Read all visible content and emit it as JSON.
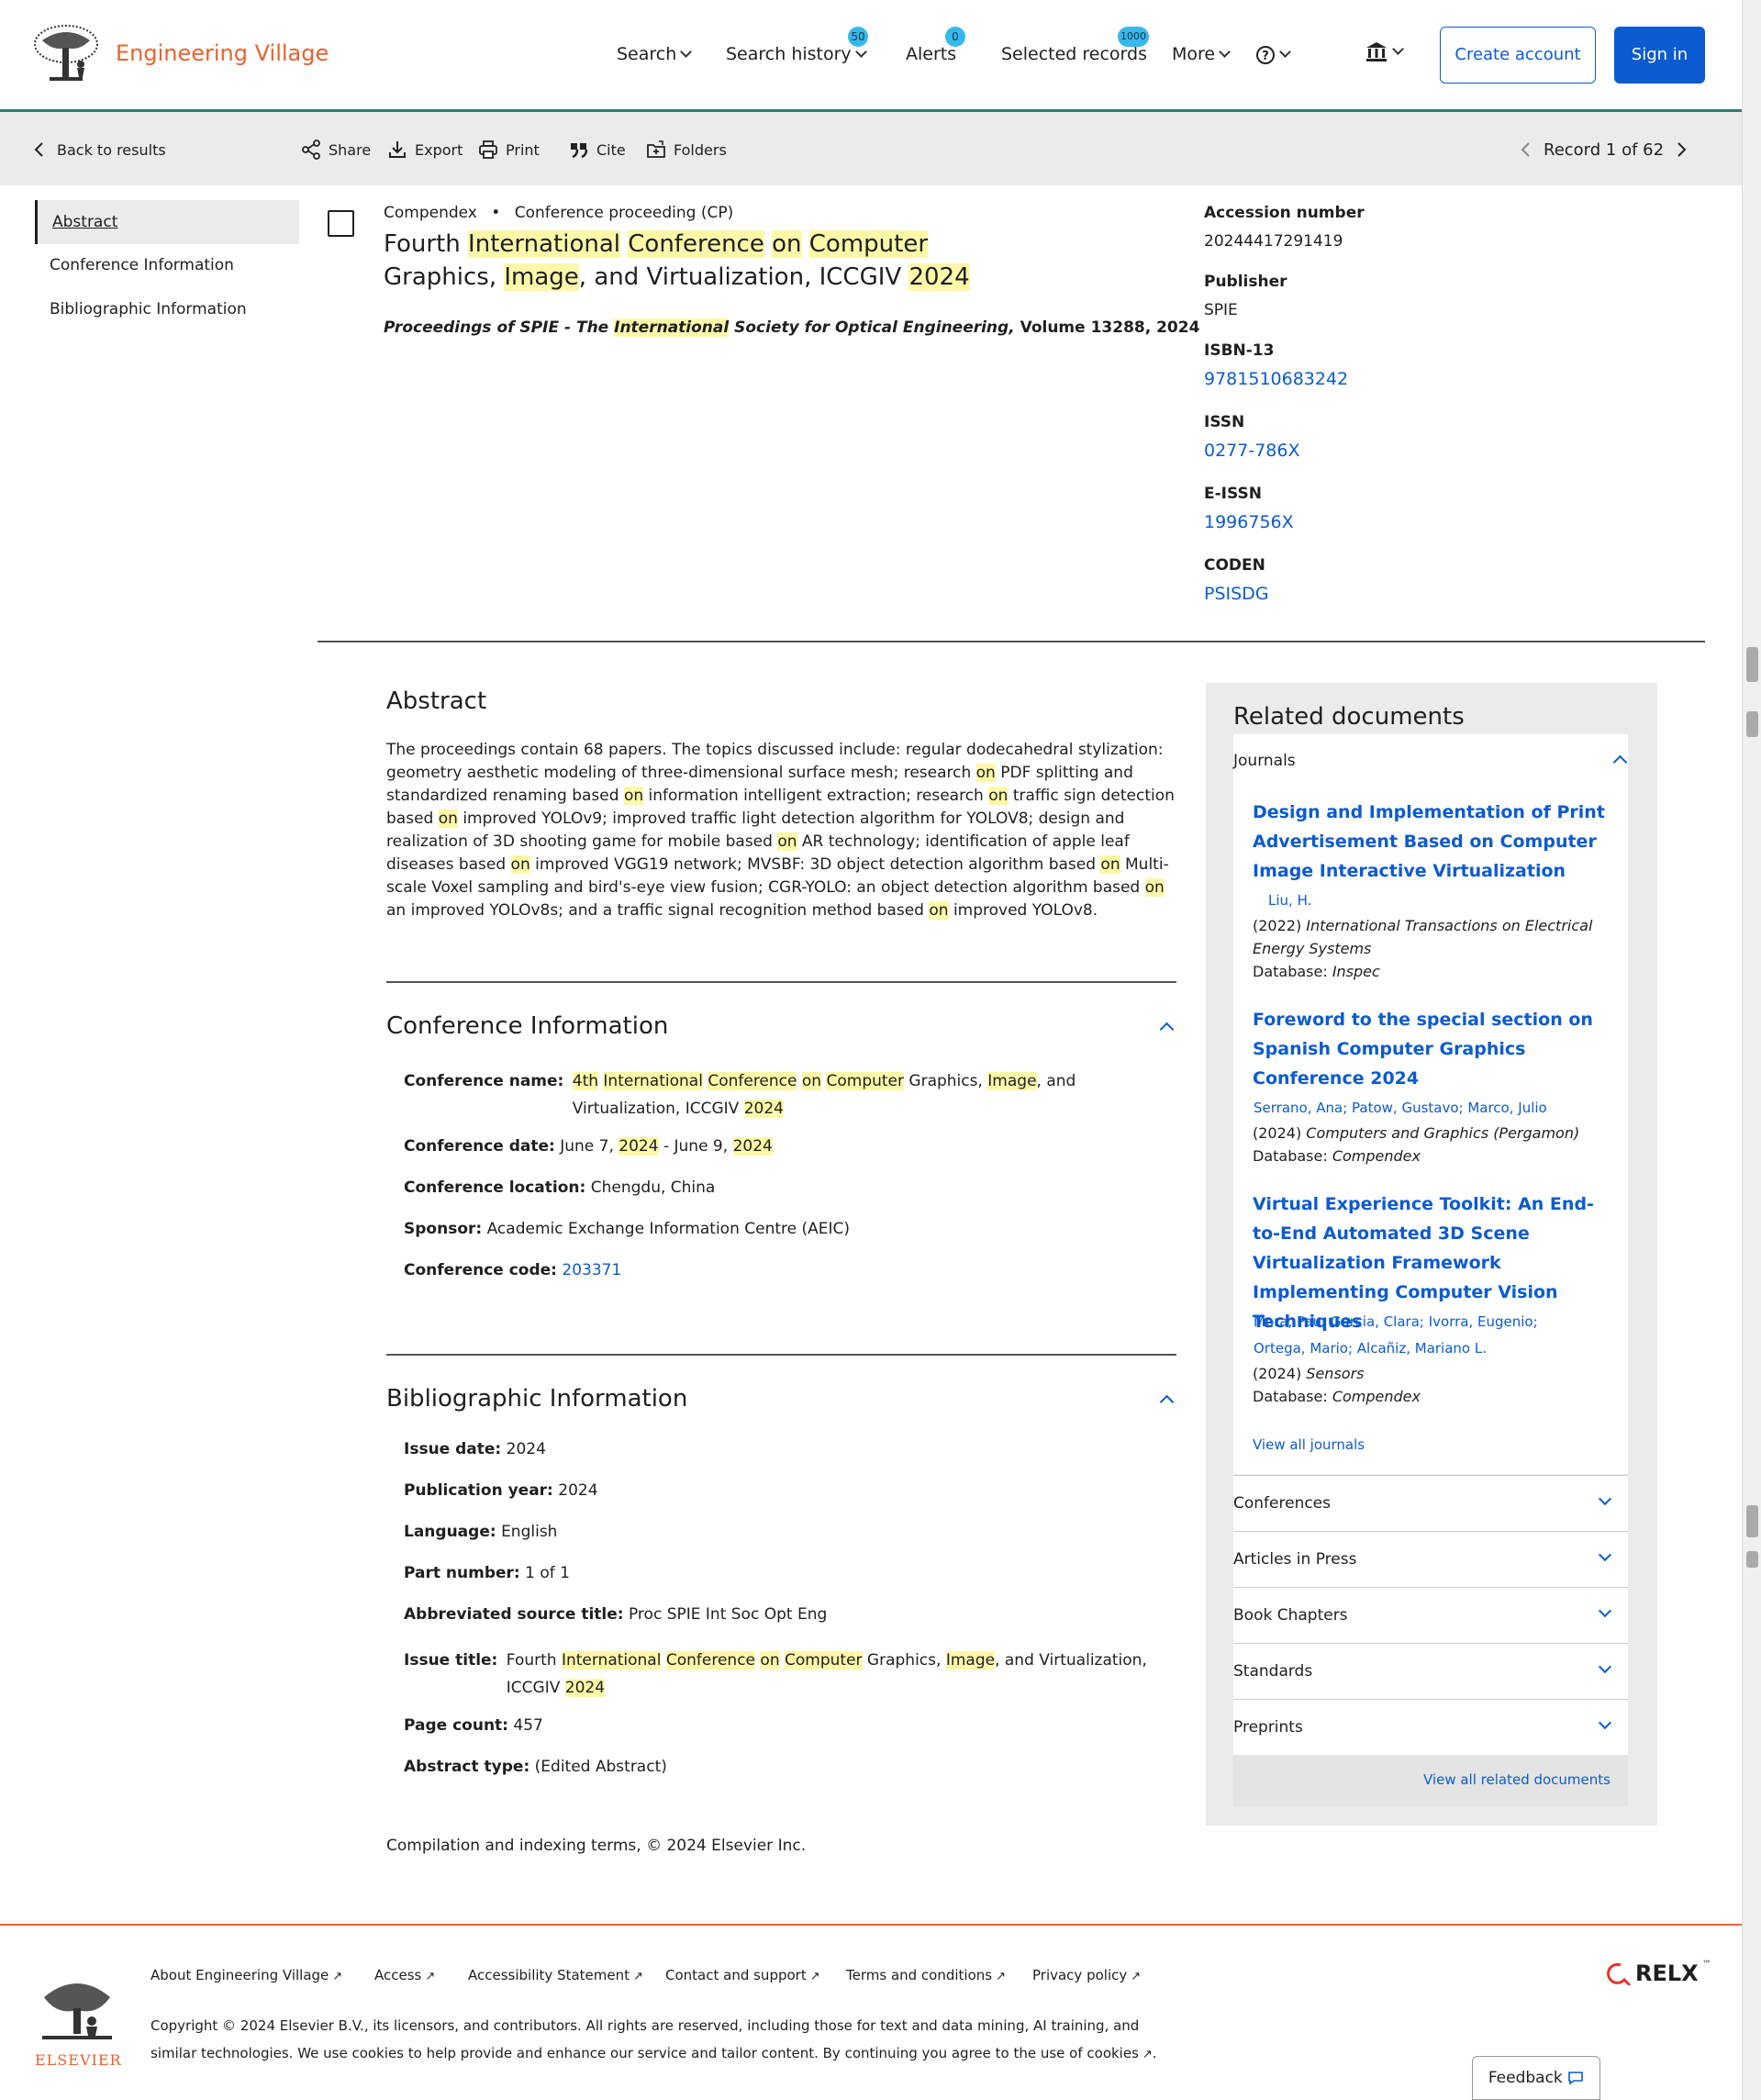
{
  "header": {
    "brand": "Engineering Village",
    "nav": {
      "search": "Search",
      "search_history": "Search history",
      "search_history_count": "50",
      "alerts": "Alerts",
      "alerts_count": "0",
      "selected_records": "Selected records",
      "selected_records_count": "1000",
      "more": "More"
    },
    "create_account": "Create account",
    "sign_in": "Sign in"
  },
  "toolbar": {
    "back": "Back to results",
    "share": "Share",
    "export": "Export",
    "print": "Print",
    "cite": "Cite",
    "folders": "Folders",
    "record": "Record 1 of 62"
  },
  "left_nav": [
    "Abstract",
    "Conference Information",
    "Bibliographic Information"
  ],
  "record": {
    "database": "Compendex",
    "doc_type": "Conference proceeding (CP)",
    "title_line1": [
      "Fourth ",
      "International",
      " ",
      "Conference",
      " ",
      "on",
      " ",
      "Computer"
    ],
    "title_line2": [
      "Graphics, ",
      "Image",
      ", and Virtualization, ICCGIV ",
      "2024"
    ],
    "source_pre": "Proceedings of SPIE - The ",
    "source_hl": "International",
    "source_post": " Society for Optical Engineering,",
    "source_vol": " Volume 13288, 2024"
  },
  "meta": {
    "accession_label": "Accession number",
    "accession_value": "20244417291419",
    "publisher_label": "Publisher",
    "publisher_value": "SPIE",
    "isbn_label": "ISBN-13",
    "isbn_value": "9781510683242",
    "issn_label": "ISSN",
    "issn_value": "0277-786X",
    "eissn_label": "E-ISSN",
    "eissn_value": "1996756X",
    "coden_label": "CODEN",
    "coden_value": "PSISDG"
  },
  "abstract": {
    "heading": "Abstract",
    "text": "The proceedings contain 68 papers. The topics discussed include: regular dodecahedral stylization: geometry aesthetic modeling of three-dimensional surface mesh; research on PDF splitting and standardized renaming based on information intelligent extraction; research on traffic sign detection based on improved YOLOv9; improved traffic light detection algorithm for YOLOV8; design and realization of 3D shooting game for mobile based on AR technology; identification of apple leaf diseases based on improved VGG19 network; MVSBF: 3D object detection algorithm based on Multi-scale Voxel sampling and bird's-eye view fusion; CGR-YOLO: an object detection algorithm based on an improved YOLOv8s; and a traffic signal recognition method based on improved YOLOv8."
  },
  "conference": {
    "heading": "Conference Information",
    "name_label": "Conference name:",
    "name_line1": [
      "4th",
      " ",
      "International",
      " ",
      "Conference",
      " ",
      "on",
      " ",
      "Computer",
      " Graphics, ",
      "Image",
      ", and"
    ],
    "name_line2": [
      "Virtualization, ICCGIV ",
      "2024"
    ],
    "date_label": "Conference date:",
    "date_parts": [
      "June 7, ",
      "2024",
      " - June 9, ",
      "2024"
    ],
    "location_label": "Conference location:",
    "location_value": "Chengdu, China",
    "sponsor_label": "Sponsor:",
    "sponsor_value": "Academic Exchange Information Centre (AEIC)",
    "code_label": "Conference code:",
    "code_value": "203371"
  },
  "bibliographic": {
    "heading": "Bibliographic Information",
    "issue_date_label": "Issue date:",
    "issue_date_value": "2024",
    "pub_year_label": "Publication year:",
    "pub_year_value": "2024",
    "language_label": "Language:",
    "language_value": "English",
    "part_label": "Part number:",
    "part_value": "1 of 1",
    "abbr_label": "Abbreviated source title:",
    "abbr_value": "Proc SPIE Int Soc Opt Eng",
    "issue_title_label": "Issue title:",
    "issue_title_line1": [
      "Fourth ",
      "International",
      " ",
      "Conference",
      " ",
      "on",
      " ",
      "Computer",
      " Graphics, ",
      "Image",
      ", and Virtualization,"
    ],
    "issue_title_line2": [
      "ICCGIV ",
      "2024"
    ],
    "page_count_label": "Page count:",
    "page_count_value": "457",
    "abstract_type_label": "Abstract type:",
    "abstract_type_value": "(Edited Abstract)"
  },
  "compilation": "Compilation and indexing terms, © 2024 Elsevier Inc.",
  "related": {
    "heading": "Related documents",
    "journals_label": "Journals",
    "items": [
      {
        "title": "Design and Implementation of Print Advertisement Based on Computer Image Interactive Virtualization",
        "authors": [
          "Liu, H."
        ],
        "year": "(2022)",
        "source": "International Transactions on Electrical Energy Systems",
        "database_label": "Database:",
        "database": "Inspec"
      },
      {
        "title": "Foreword to the special section on Spanish Computer Graphics Conference 2024",
        "authors": [
          "Serrano, Ana; Patow, Gustavo; Marco, Julio"
        ],
        "year": "(2024)",
        "source": "Computers and Graphics (Pergamon)",
        "database_label": "Database:",
        "database": "Compendex"
      },
      {
        "title": "Virtual Experience Toolkit: An End-to-End Automated 3D Scene Virtualization Framework Implementing Computer Vision Techniques",
        "authors": [
          "Mora, Pau; Garcia, Clara; Ivorra, Eugenio;",
          "Ortega, Mario; Alcañiz, Mariano L."
        ],
        "year": "(2024)",
        "source": "Sensors",
        "database_label": "Database:",
        "database": "Compendex"
      }
    ],
    "view_all_journals": "View all journals",
    "categories": [
      "Conferences",
      "Articles in Press",
      "Book Chapters",
      "Standards",
      "Preprints"
    ],
    "view_all_related": "View all related documents"
  },
  "footer": {
    "links": [
      "About Engineering Village",
      "Access",
      "Accessibility Statement",
      "Contact and support",
      "Terms and conditions",
      "Privacy policy"
    ],
    "copyright": "Copyright © 2024 Elsevier B.V., its licensors, and contributors. All rights are reserved, including those for text and data mining, AI training, and similar technologies. We use cookies to help provide and enhance our service and tailor content. By continuing you agree to the use of cookies",
    "elsevier": "ELSEVIER",
    "relx": "RELX",
    "feedback": "Feedback"
  }
}
